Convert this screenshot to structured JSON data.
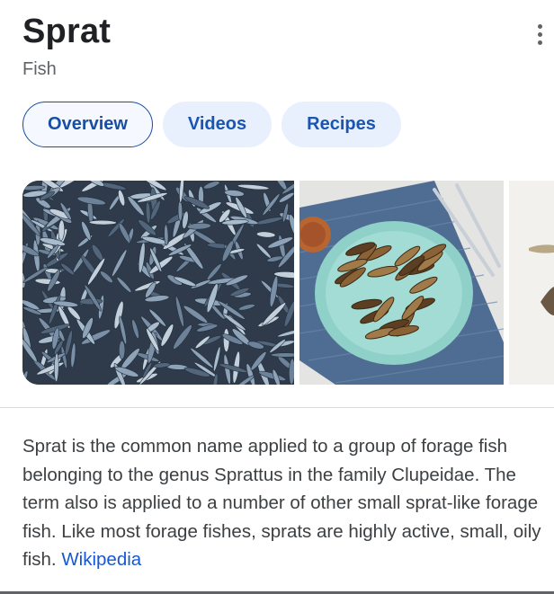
{
  "header": {
    "title": "Sprat",
    "subtitle": "Fish",
    "more_icon": "more-vert-icon"
  },
  "tabs": [
    {
      "label": "Overview",
      "active": true
    },
    {
      "label": "Videos",
      "active": false
    },
    {
      "label": "Recipes",
      "active": false
    }
  ],
  "images": [
    {
      "subject": "pile of silvery sprats"
    },
    {
      "subject": "fried sprats on a blue plate with forks"
    },
    {
      "subject": "partially visible fish image"
    }
  ],
  "description": {
    "text": "Sprat is the common name applied to a group of forage fish belonging to the genus Sprattus in the family Clupeidae. The term also is applied to a number of other small sprat-like forage fish. Like most forage fishes, sprats are highly active, small, oily fish.",
    "source_link": "Wikipedia"
  },
  "colors": {
    "accent": "#174ea6",
    "chip_bg": "#e8f0fe",
    "link": "#1558d6",
    "text": "#3c4043"
  }
}
